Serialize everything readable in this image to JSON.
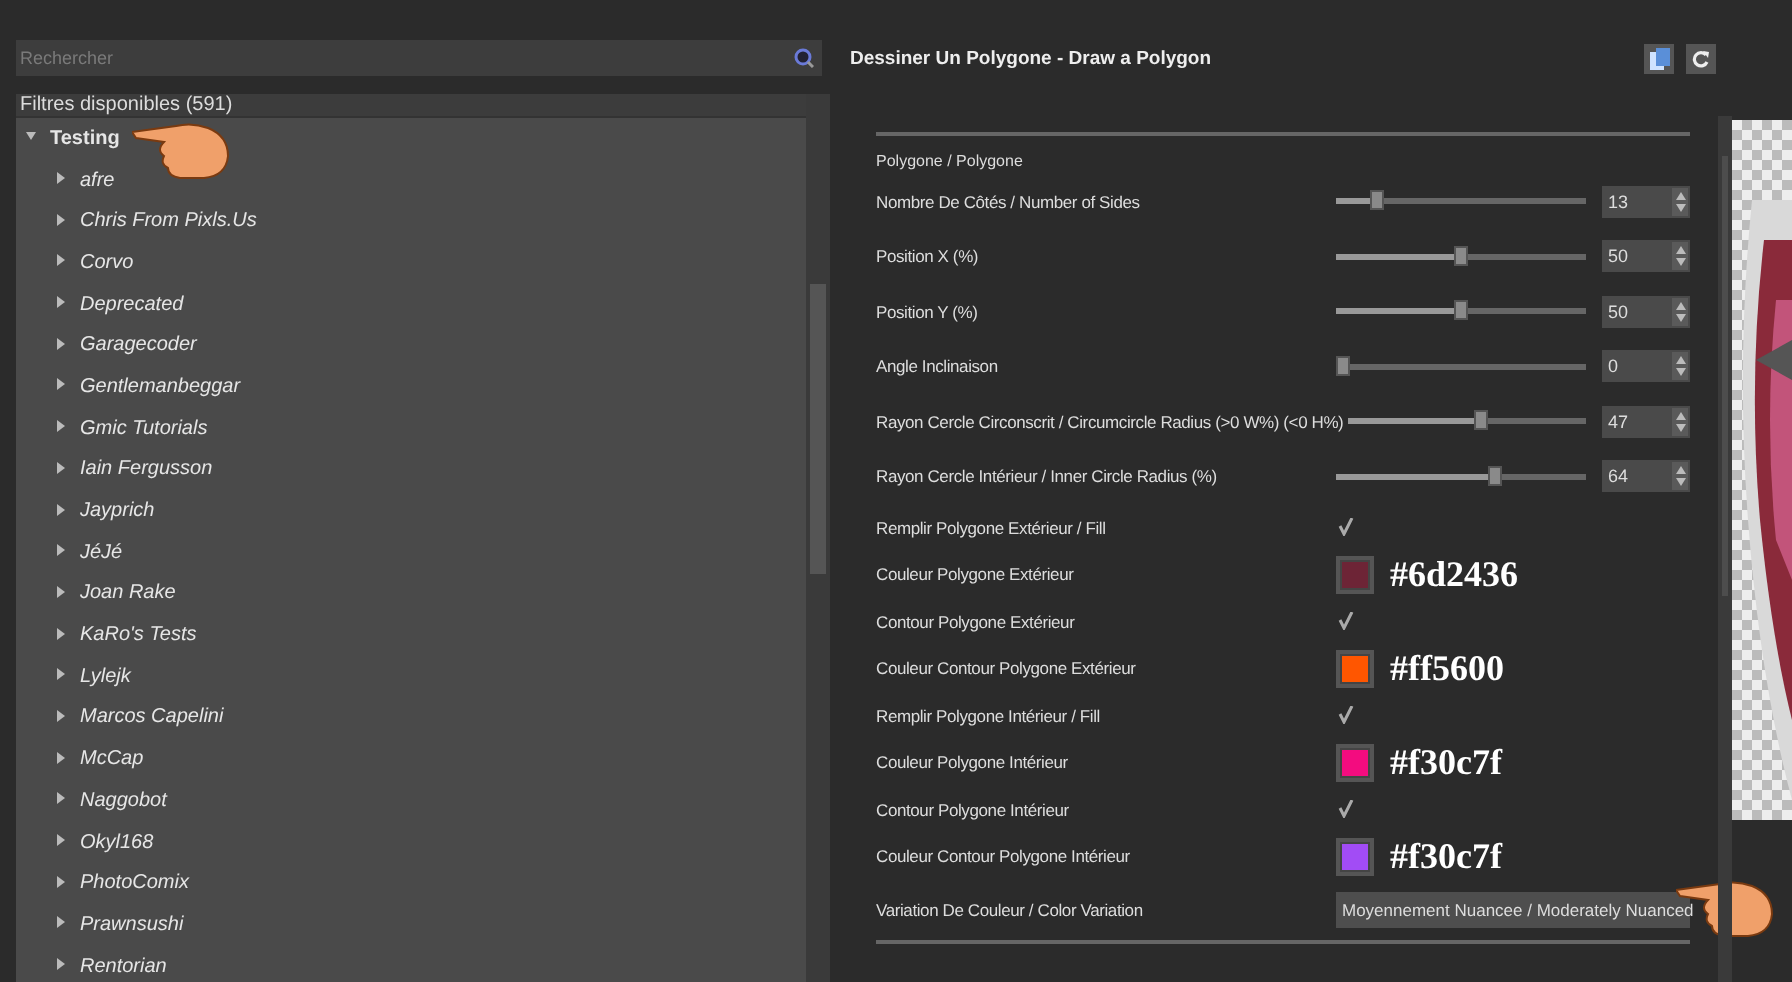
{
  "search": {
    "placeholder": "Rechercher"
  },
  "filters_header": "Filtres disponibles (591)",
  "tree": [
    {
      "label": "Testing",
      "expanded": true,
      "children": [
        {
          "label": "afre",
          "expanded": false
        },
        {
          "label": "Chris From Pixls.Us",
          "expanded": false
        },
        {
          "label": "Corvo",
          "expanded": false
        },
        {
          "label": "Deprecated",
          "expanded": false
        },
        {
          "label": "Garagecoder",
          "expanded": false
        },
        {
          "label": "Gentlemanbeggar",
          "expanded": false
        },
        {
          "label": "Gmic Tutorials",
          "expanded": false
        },
        {
          "label": "Iain Fergusson",
          "expanded": false
        },
        {
          "label": "Jayprich",
          "expanded": false
        },
        {
          "label": "JéJé",
          "expanded": false
        },
        {
          "label": "Joan Rake",
          "expanded": false
        },
        {
          "label": "KaRo's Tests",
          "expanded": false
        },
        {
          "label": "Lylejk",
          "expanded": false
        },
        {
          "label": "Marcos Capelini",
          "expanded": false
        },
        {
          "label": "McCap",
          "expanded": false
        },
        {
          "label": "Naggobot",
          "expanded": false
        },
        {
          "label": "Okyl168",
          "expanded": false
        },
        {
          "label": "PhotoComix",
          "expanded": false
        },
        {
          "label": "Prawnsushi",
          "expanded": false
        },
        {
          "label": "Rentorian",
          "expanded": false
        }
      ]
    }
  ],
  "filter_title": "Dessiner Un Polygone - Draw a Polygon",
  "section": "Polygone / Polygone",
  "params": [
    {
      "kind": "slider",
      "label": "Nombre De Côtés / Number of Sides",
      "level": 0.14,
      "value": "13"
    },
    {
      "kind": "slider",
      "label": "Position X (%)",
      "level": 0.5,
      "value": "50"
    },
    {
      "kind": "slider",
      "label": "Position Y (%)",
      "level": 0.5,
      "value": "50"
    },
    {
      "kind": "slider",
      "label": "Angle Inclinaison",
      "level": 0,
      "value": "0"
    },
    {
      "kind": "slider",
      "label": "Rayon Cercle Circonscrit / Circumcircle Radius (>0 W%) (<0 H%)",
      "level": 0.56,
      "value": "47"
    },
    {
      "kind": "slider",
      "label": "Rayon Cercle Intérieur / Inner Circle Radius (%)",
      "level": 0.64,
      "value": "64"
    },
    {
      "kind": "checkbox",
      "label": "Remplir Polygone Extérieur / Fill",
      "checked": true
    },
    {
      "kind": "color",
      "label": "Couleur Polygone Extérieur",
      "color": "#6d2436",
      "annotation": "#6d2436"
    },
    {
      "kind": "checkbox",
      "label": "Contour Polygone Extérieur",
      "checked": true
    },
    {
      "kind": "color",
      "label": "Couleur Contour Polygone Extérieur",
      "color": "#ff5600",
      "annotation": "#ff5600"
    },
    {
      "kind": "checkbox",
      "label": "Remplir Polygone Intérieur / Fill",
      "checked": true
    },
    {
      "kind": "color",
      "label": "Couleur Polygone Intérieur",
      "color": "#f30c7f",
      "annotation": "#f30c7f"
    },
    {
      "kind": "checkbox",
      "label": "Contour Polygone Intérieur",
      "checked": true
    },
    {
      "kind": "color",
      "label": "Couleur Contour Polygone Intérieur",
      "color": "#a24cf5",
      "annotation": "#f30c7f"
    },
    {
      "kind": "select",
      "label": "Variation De Couleur / Color Variation",
      "value": "Moyennement Nuancee / Moderately Nuanced"
    }
  ]
}
